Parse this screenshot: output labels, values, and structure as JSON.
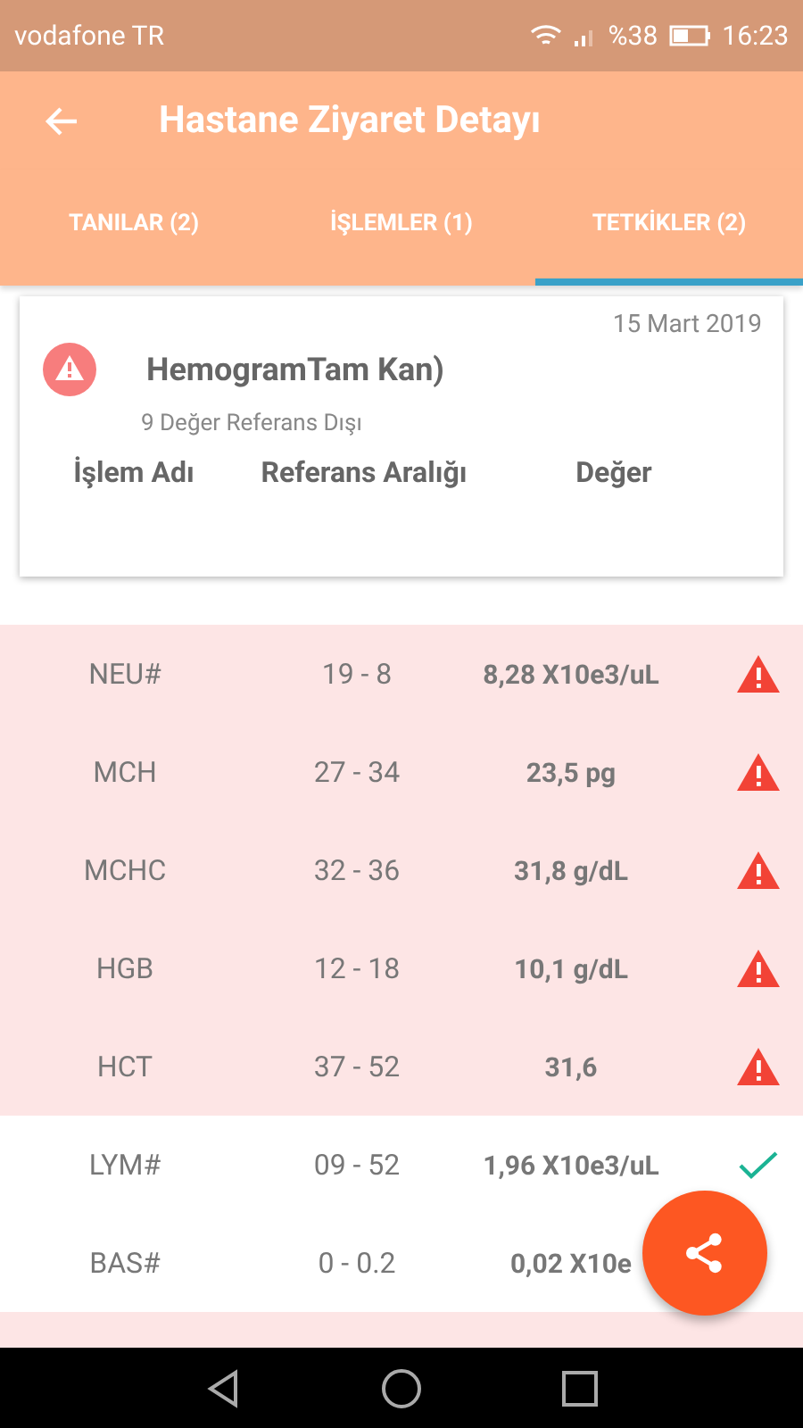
{
  "status_bar": {
    "carrier": "vodafone TR",
    "battery": "%38",
    "time": "16:23"
  },
  "app_bar": {
    "title": "Hastane Ziyaret Detayı"
  },
  "tabs": [
    {
      "label": "TANILAR (2)",
      "selected": false
    },
    {
      "label": "İŞLEMLER (1)",
      "selected": false
    },
    {
      "label": "TETKİKLER (2)",
      "selected": true
    }
  ],
  "test_card": {
    "date": "15 Mart 2019",
    "title": "HemogramTam Kan)",
    "subtitle": "9 Değer Referans Dışı",
    "columns": [
      "İşlem Adı",
      "Referans Aralığı",
      "Değer"
    ]
  },
  "rows": [
    {
      "name": "NEU#",
      "range": "19 - 8",
      "value": "8,28 X10e3/uL",
      "out_of_range": true
    },
    {
      "name": "MCH",
      "range": "27 - 34",
      "value": "23,5 pg",
      "out_of_range": true
    },
    {
      "name": "MCHC",
      "range": "32 - 36",
      "value": "31,8 g/dL",
      "out_of_range": true
    },
    {
      "name": "HGB",
      "range": "12 - 18",
      "value": "10,1 g/dL",
      "out_of_range": true
    },
    {
      "name": "HCT",
      "range": "37 - 52",
      "value": "31,6",
      "out_of_range": true
    },
    {
      "name": "LYM#",
      "range": "09 - 52",
      "value": "1,96 X10e3/uL",
      "out_of_range": false
    },
    {
      "name": "BAS#",
      "range": "0 - 0.2",
      "value": "0,02 X10e",
      "out_of_range": false,
      "icon_hidden": true
    }
  ]
}
